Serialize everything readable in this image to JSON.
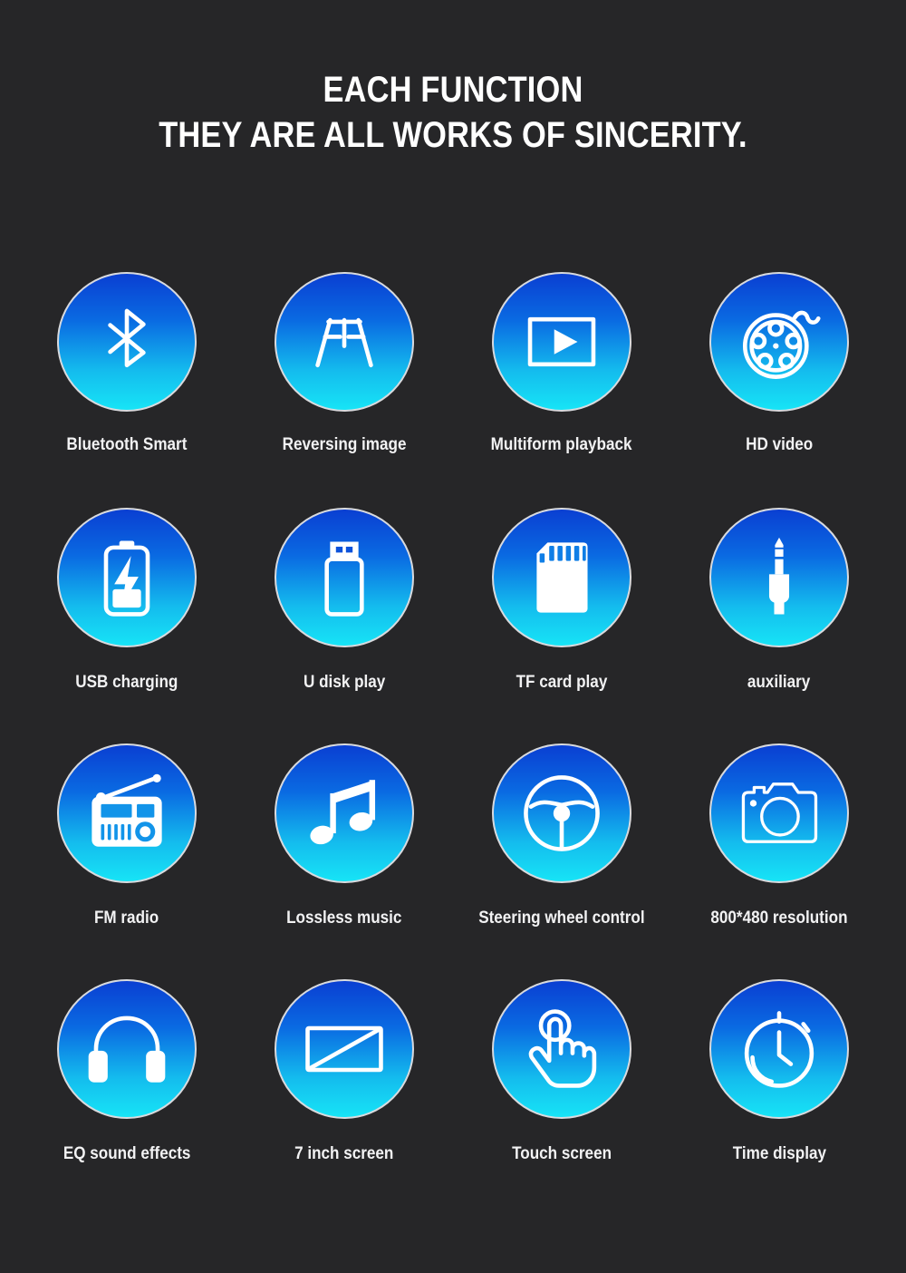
{
  "theme": {
    "background": "#262628",
    "circle_gradient_top": "#0a3fd2",
    "circle_gradient_bottom": "#17e4f6",
    "circle_ring": "#d8dade",
    "text_color": "#f2f2f3"
  },
  "header": {
    "line1": "EACH FUNCTION",
    "line2": "THEY ARE ALL WORKS OF SINCERITY."
  },
  "features": [
    {
      "icon": "bluetooth-icon",
      "label": "Bluetooth Smart"
    },
    {
      "icon": "reversing-guide-icon",
      "label": "Reversing image"
    },
    {
      "icon": "video-play-icon",
      "label": "Multiform playback"
    },
    {
      "icon": "film-reel-icon",
      "label": "HD video"
    },
    {
      "icon": "battery-charging-icon",
      "label": "USB charging"
    },
    {
      "icon": "usb-drive-icon",
      "label": "U disk play"
    },
    {
      "icon": "sd-card-icon",
      "label": "TF card play"
    },
    {
      "icon": "audio-jack-icon",
      "label": "auxiliary"
    },
    {
      "icon": "radio-icon",
      "label": "FM radio"
    },
    {
      "icon": "music-note-icon",
      "label": "Lossless music"
    },
    {
      "icon": "steering-wheel-icon",
      "label": "Steering wheel control"
    },
    {
      "icon": "camera-icon",
      "label": "800*480 resolution"
    },
    {
      "icon": "headphones-icon",
      "label": "EQ sound effects"
    },
    {
      "icon": "screen-diagonal-icon",
      "label": "7 inch screen"
    },
    {
      "icon": "touch-hand-icon",
      "label": "Touch screen"
    },
    {
      "icon": "stopwatch-icon",
      "label": "Time display"
    }
  ]
}
